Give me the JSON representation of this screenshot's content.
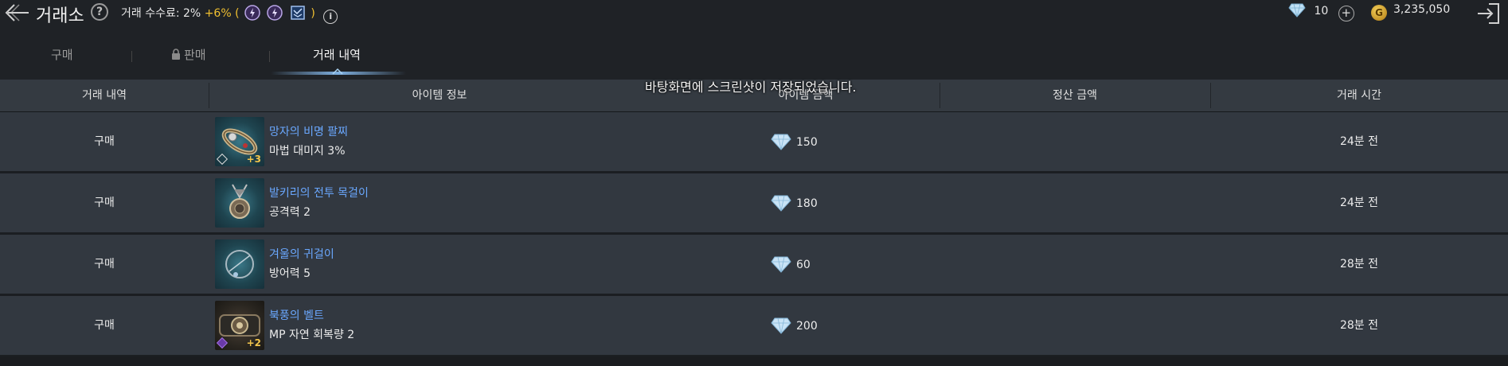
{
  "header": {
    "title": "거래소",
    "help_label": "?",
    "fee_text": "거래 수수료: 2%",
    "fee_bonus": "+6%",
    "paren_open": "(",
    "paren_close": ")",
    "info_label": "i",
    "buffs": [
      "crystal-buff-icon",
      "crystal-buff-icon",
      "scroll-buff-icon"
    ]
  },
  "currency": {
    "crystal_count": "10",
    "add_label": "+",
    "gold_symbol": "G",
    "gold_amount": "3,235,050"
  },
  "tabs": [
    {
      "label": "구매",
      "active": false,
      "locked": false
    },
    {
      "label": "판매",
      "active": false,
      "locked": true
    },
    {
      "label": "거래 내역",
      "active": true,
      "locked": false
    }
  ],
  "table": {
    "columns": [
      "거래 내역",
      "아이템 정보",
      "아이템 금액",
      "정산 금액",
      "거래 시간"
    ],
    "rows": [
      {
        "type": "구매",
        "name": "망자의 비명 팔찌",
        "stat": "마법 대미지 3%",
        "level": "+3",
        "price": "150",
        "settlement": "",
        "time": "24분 전"
      },
      {
        "type": "구매",
        "name": "발키리의 전투 목걸이",
        "stat": "공격력 2",
        "level": "",
        "price": "180",
        "settlement": "",
        "time": "24분 전"
      },
      {
        "type": "구매",
        "name": "겨울의 귀걸이",
        "stat": "방어력 5",
        "level": "",
        "price": "60",
        "settlement": "",
        "time": "28분 전"
      },
      {
        "type": "구매",
        "name": "북풍의 벨트",
        "stat": "MP 자연 회복량 2",
        "level": "+2",
        "price": "200",
        "settlement": "",
        "time": "28분 전"
      }
    ]
  },
  "toast": "바탕화면에 스크린샷이 저장되었습니다.",
  "colors": {
    "item_name": "#6aa8ff",
    "fee_bonus": "#f0c030",
    "level": "#f2c54c"
  }
}
